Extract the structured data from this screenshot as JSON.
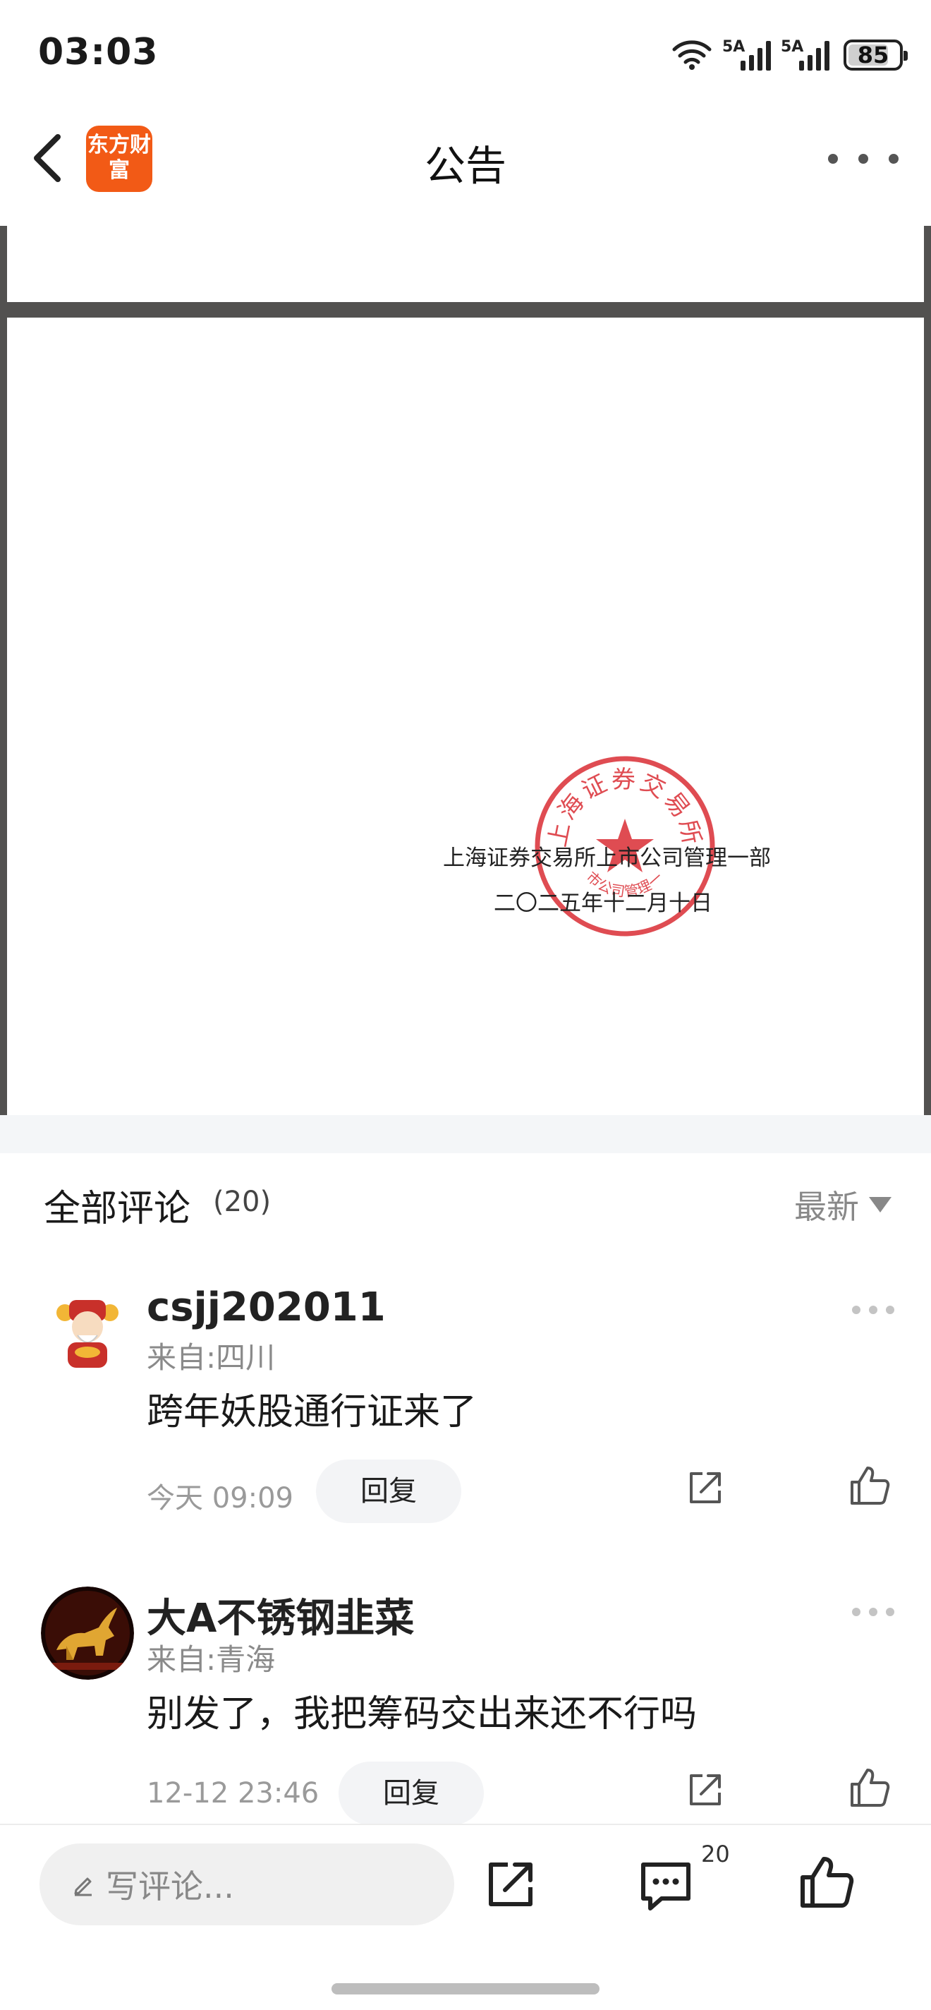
{
  "status_bar": {
    "time": "03:03",
    "signal1_label": "5A",
    "signal2_label": "5A",
    "battery": "85",
    "battery_level": 0.85
  },
  "header": {
    "app_logo_text": "东方财富",
    "title": "公告",
    "back_icon": "chevron-left-icon",
    "more_icon": "more-horizontal-icon"
  },
  "document": {
    "line1": "上海证券交易所上市公司管理一部",
    "line2": "二〇二五年十二月十日",
    "seal_text": "上海证券交易所",
    "seal_bottom_text": "上市公司管理一部",
    "seal_color": "#d9262d"
  },
  "comments": {
    "title": "全部评论",
    "count": "(20)",
    "sort_label": "最新",
    "items": [
      {
        "user": "csjj202011",
        "location": "来自:四川",
        "text": "跨年妖股通行证来了",
        "time": "今天 09:09",
        "reply_label": "回复"
      },
      {
        "user": "大A不锈钢韭菜",
        "location": "来自:青海",
        "text": "别发了，我把筹码交出来还不行吗",
        "time": "12-12 23:46",
        "reply_label": "回复"
      }
    ]
  },
  "bottom_bar": {
    "input_placeholder": "写评论...",
    "comment_count": "20",
    "icons": [
      "pencil-icon",
      "share-icon",
      "comment-icon",
      "thumbs-up-icon"
    ]
  },
  "colors": {
    "brand": "#f25a16",
    "seal": "#d9262d",
    "doc_background": "#525150"
  }
}
